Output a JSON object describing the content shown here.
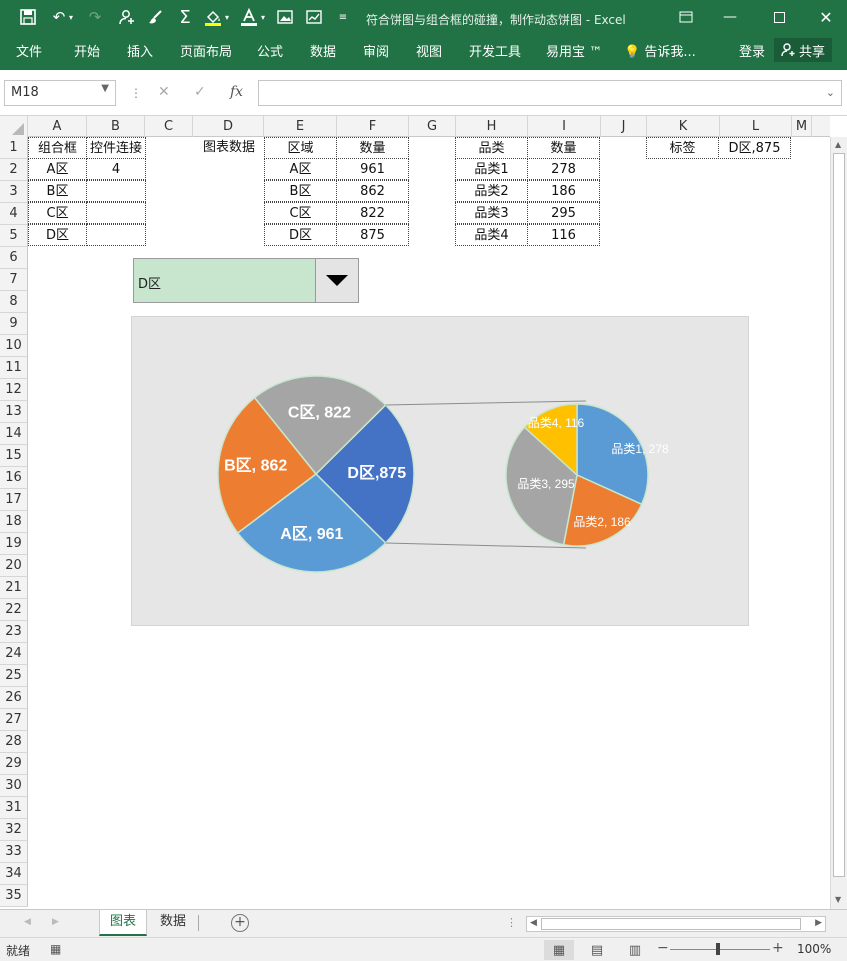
{
  "window": {
    "title": "符合饼图与组合框的碰撞，制作动态饼图 - Excel",
    "qat_icons": [
      "save-icon",
      "undo-icon",
      "redo-icon",
      "add-person-icon",
      "brush-icon",
      "sum-icon",
      "fill-color-icon",
      "font-color-icon",
      "image-icon",
      "chart-icon",
      "customize-icon"
    ]
  },
  "ribbon": {
    "tabs": [
      "文件",
      "开始",
      "插入",
      "页面布局",
      "公式",
      "数据",
      "审阅",
      "视图",
      "开发工具",
      "易用宝 ™"
    ],
    "tell_me": "告诉我...",
    "login": "登录",
    "share": "共享"
  },
  "formula_bar": {
    "name_box": "M18",
    "fx_label": "fx",
    "formula": ""
  },
  "grid": {
    "columns": [
      "A",
      "B",
      "C",
      "D",
      "E",
      "F",
      "G",
      "H",
      "I",
      "J",
      "K",
      "L",
      "M"
    ],
    "rows": [
      "1",
      "2",
      "3",
      "4",
      "5",
      "6",
      "7",
      "8",
      "9",
      "10",
      "11",
      "12",
      "13",
      "14",
      "15",
      "16",
      "17",
      "18",
      "19",
      "20",
      "21",
      "22",
      "23",
      "24",
      "25",
      "26",
      "27",
      "28",
      "29",
      "30",
      "31",
      "32",
      "33",
      "34",
      "35"
    ],
    "table_ab": {
      "header": [
        "组合框",
        "控件连接"
      ],
      "rows": [
        [
          "A区",
          "4"
        ],
        [
          "B区",
          ""
        ],
        [
          "C区",
          ""
        ],
        [
          "D区",
          ""
        ]
      ]
    },
    "d1_label": "图表数据",
    "table_ef": {
      "header": [
        "区域",
        "数量"
      ],
      "rows": [
        [
          "A区",
          "961"
        ],
        [
          "B区",
          "862"
        ],
        [
          "C区",
          "822"
        ],
        [
          "D区",
          "875"
        ]
      ]
    },
    "table_hi": {
      "header": [
        "品类",
        "数量"
      ],
      "rows": [
        [
          "品类1",
          "278"
        ],
        [
          "品类2",
          "186"
        ],
        [
          "品类3",
          "295"
        ],
        [
          "品类4",
          "116"
        ]
      ]
    },
    "table_kl": {
      "header": [
        "标签",
        "D区,875"
      ]
    }
  },
  "combo_box": {
    "value": "D区"
  },
  "chart_data": {
    "type": "pie",
    "main": {
      "categories": [
        "A区",
        "B区",
        "C区",
        "D区"
      ],
      "values": [
        961,
        862,
        822,
        875
      ],
      "labels": [
        "A区, 961",
        "B区, 862",
        "C区, 822",
        "D区,875"
      ],
      "colors": [
        "#5b9bd5",
        "#ed7d31",
        "#a5a5a5",
        "#4472c4"
      ]
    },
    "secondary": {
      "categories": [
        "品类1",
        "品类2",
        "品类3",
        "品类4"
      ],
      "values": [
        278,
        186,
        295,
        116
      ],
      "labels": [
        "品类1, 278",
        "品类2, 186",
        "品类3, 295",
        "品类4, 116"
      ],
      "colors": [
        "#5b9bd5",
        "#ed7d31",
        "#a5a5a5",
        "#ffc000"
      ]
    }
  },
  "sheets": {
    "tabs": [
      "图表",
      "数据"
    ],
    "active": "图表"
  },
  "status": {
    "text": "就绪",
    "zoom": "100%"
  }
}
